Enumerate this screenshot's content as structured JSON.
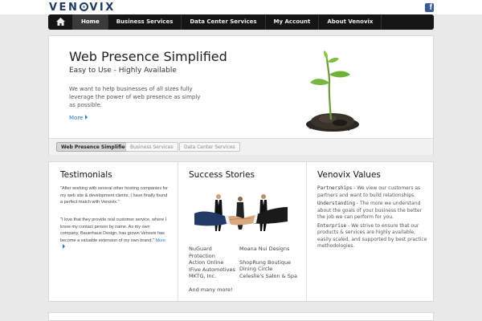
{
  "brand": {
    "logo_text_left": "VEN",
    "logo_text_right": "VIX"
  },
  "social": {
    "facebook_glyph": "f"
  },
  "nav": {
    "items": [
      {
        "label": "Home",
        "active": true
      },
      {
        "label": "Business Services",
        "active": false
      },
      {
        "label": "Data Center Services",
        "active": false
      },
      {
        "label": "My Account",
        "active": false
      },
      {
        "label": "About Venovix",
        "active": false
      }
    ]
  },
  "hero": {
    "title": "Web Presence Simplified",
    "subtitle": "Easy to Use - Highly Available",
    "body": "We want to help businesses of all sizes fully leverage the power of web presence as simply as possible.",
    "more_label": "More",
    "tabs": [
      {
        "label": "Web Presence Simplified",
        "active": true
      },
      {
        "label": "Business Services",
        "active": false
      },
      {
        "label": "Data Center Services",
        "active": false
      }
    ]
  },
  "testimonials": {
    "title": "Testimonials",
    "quote1": "\"After working with several other hosting companies for my web site & development clients, I have finally found a perfect match with Venovix.\"",
    "quote2": "\"I love that they provide real customer service, where I know my contact person by name. As my own company, Bauerhaus Design, has grown Venovix has become a valuable extension of my own brand.\"",
    "more_label": "More"
  },
  "stories": {
    "title": "Success Stories",
    "left": [
      "NuGuard Protection",
      "Action Online",
      "IFive Automotives",
      "MKTG, Inc.",
      "",
      "And many more!"
    ],
    "right": [
      "Moana Nui Designs",
      "",
      "ShopRung Boutique",
      "Dining Circle",
      "Celeslie's Salon & Spa"
    ]
  },
  "values": {
    "title": "Venovix Values",
    "items": [
      {
        "key": "Partnerships",
        "text": " - We view our customers as partners and want to build relationships."
      },
      {
        "key": "Understanding",
        "text": " - The more we understand about the goals of your business the better the job we can perform for you."
      },
      {
        "key": "Enterprise",
        "text": " - We strive to ensure that our products & services are highly available, easily scaled, and supported by best practice methodologies."
      }
    ]
  },
  "colors": {
    "accent": "#2a7fc1",
    "nav_bg": "#151515",
    "brand": "#1d3b5c",
    "facebook": "#3b5998"
  }
}
